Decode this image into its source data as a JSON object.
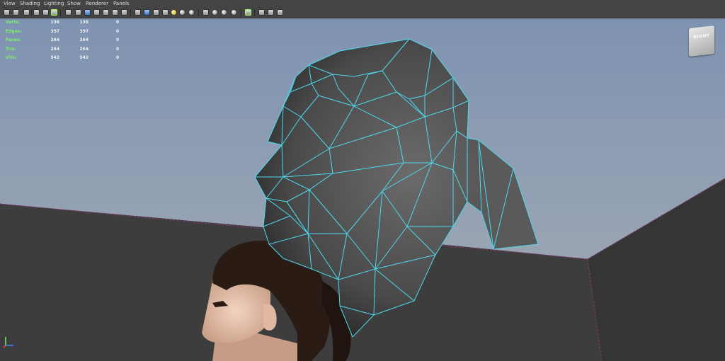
{
  "menu": {
    "items": [
      {
        "label": "View"
      },
      {
        "label": "Shading"
      },
      {
        "label": "Lighting"
      },
      {
        "label": "Show"
      },
      {
        "label": "Renderer"
      },
      {
        "label": "Panels"
      }
    ]
  },
  "toolbar": {
    "icons": [
      "select-camera-icon",
      "camera-attributes-icon",
      "bookmark-icon",
      "image-plane-icon",
      "grid-icon",
      "film-gate-icon",
      "resolution-gate-icon",
      "gate-mask-icon",
      "field-chart-icon",
      "safe-action-icon",
      "safe-title-icon",
      "wireframe-icon",
      "smooth-shade-icon",
      "flat-shade-icon",
      "bounding-box-icon",
      "points-icon",
      "use-default-material-icon",
      "wireframe-on-shaded-icon",
      "xray-icon",
      "xray-joints-icon",
      "textured-icon",
      "default-lighting-icon",
      "use-all-lights-icon",
      "shadows-icon",
      "high-quality-icon",
      "isolate-select-icon",
      "motion-blur-icon",
      "ambient-occlusion-icon",
      "anti-aliasing-icon",
      "depth-of-field-icon",
      "two-panel-icon",
      "four-panel-icon"
    ]
  },
  "heads_up_display": {
    "rows": [
      {
        "label": "Verts:",
        "values": [
          "136",
          "136",
          "0"
        ]
      },
      {
        "label": "Edges:",
        "values": [
          "397",
          "397",
          "0"
        ]
      },
      {
        "label": "Faces:",
        "values": [
          "264",
          "264",
          "0"
        ]
      },
      {
        "label": "Tris:",
        "values": [
          "264",
          "264",
          "0"
        ]
      },
      {
        "label": "UVs:",
        "values": [
          "542",
          "542",
          "0"
        ]
      }
    ]
  },
  "viewcube": {
    "face_label": "RIGHT"
  },
  "colors": {
    "wireframe": "#4fd9ee",
    "grid_line": "#7a3a6a",
    "background_top": "#7e93b2",
    "background_bottom": "#9aa5b3",
    "hud_label": "#7cf06b",
    "floor": "#3c3c3c"
  },
  "viewport": {
    "mesh": "low-poly head with ponytail, shaded gray with cyan wireframe",
    "reference_image": "image plane of a woman's head in profile"
  }
}
